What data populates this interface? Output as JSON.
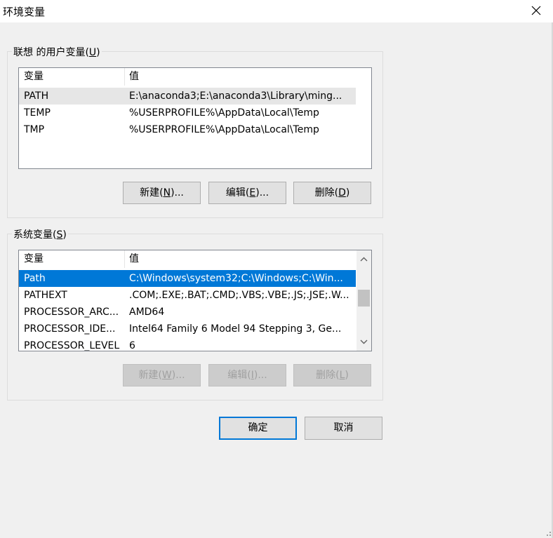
{
  "window": {
    "title": "环境变量"
  },
  "user_vars": {
    "group_title_prefix": "联想 的用户变量(",
    "group_title_key": "U",
    "group_title_suffix": ")",
    "col_name": "变量",
    "col_value": "值",
    "rows": [
      {
        "name": "PATH",
        "value": "E:\\anaconda3;E:\\anaconda3\\Library\\ming..."
      },
      {
        "name": "TEMP",
        "value": "%USERPROFILE%\\AppData\\Local\\Temp"
      },
      {
        "name": "TMP",
        "value": "%USERPROFILE%\\AppData\\Local\\Temp"
      }
    ],
    "buttons": {
      "new": {
        "prefix": "新建(",
        "key": "N",
        "suffix": ")..."
      },
      "edit": {
        "prefix": "编辑(",
        "key": "E",
        "suffix": ")..."
      },
      "delete": {
        "prefix": "删除(",
        "key": "D",
        "suffix": ")"
      }
    }
  },
  "system_vars": {
    "group_title_prefix": "系统变量(",
    "group_title_key": "S",
    "group_title_suffix": ")",
    "col_name": "变量",
    "col_value": "值",
    "rows": [
      {
        "name": "Path",
        "value": "C:\\Windows\\system32;C:\\Windows;C:\\Win..."
      },
      {
        "name": "PATHEXT",
        "value": ".COM;.EXE;.BAT;.CMD;.VBS;.VBE;.JS;.JSE;.W..."
      },
      {
        "name": "PROCESSOR_ARC...",
        "value": "AMD64"
      },
      {
        "name": "PROCESSOR_IDE...",
        "value": "Intel64 Family 6 Model 94 Stepping 3, Ge..."
      },
      {
        "name": "PROCESSOR_LEVEL",
        "value": "6"
      }
    ],
    "buttons": {
      "new": {
        "prefix": "新建(",
        "key": "W",
        "suffix": ")..."
      },
      "edit": {
        "prefix": "编辑(",
        "key": "I",
        "suffix": ")..."
      },
      "delete": {
        "prefix": "删除(",
        "key": "L",
        "suffix": ")"
      }
    }
  },
  "dialog_buttons": {
    "ok": "确定",
    "cancel": "取消"
  },
  "colors": {
    "selection_blue": "#0078d7",
    "selection_grey": "#e6e6e6"
  }
}
